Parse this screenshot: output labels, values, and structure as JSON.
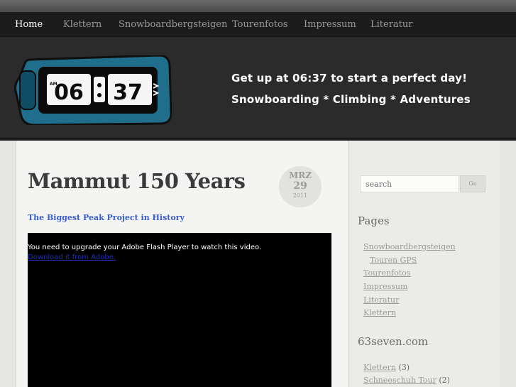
{
  "nav": {
    "items": [
      "Home",
      "Klettern",
      "Snowboardbergsteigen",
      "Tourenfotos",
      "Impressum",
      "Literatur"
    ],
    "active": "Home"
  },
  "header": {
    "clock": {
      "am_label": "AM",
      "hours": "06",
      "minutes": "37"
    },
    "tagline_1": "Get up at 06:37 to start a perfect day!",
    "tagline_2": "Snowboarding * Climbing *  Adventures"
  },
  "post": {
    "title": "Mammut 150 Years",
    "date": {
      "month": "MRZ",
      "day": "29",
      "year": "2011"
    },
    "subtitle": "The Biggest Peak Project in History",
    "video": {
      "message": "You need to upgrade your Adobe Flash Player to watch this video.",
      "link": "Download it from Adobe."
    }
  },
  "sidebar": {
    "search_placeholder": "search",
    "go_label": "Go",
    "pages_heading": "Pages",
    "pages": [
      "Snowboardbergsteigen",
      "Touren GPS",
      "Tourenfotos",
      "Impressum",
      "Literatur",
      "Klettern"
    ],
    "blog_heading": "63seven.com",
    "categories": [
      {
        "label": "Klettern",
        "count": "(3)"
      },
      {
        "label": "Schneeschuh Tour",
        "count": "(2)"
      }
    ]
  },
  "colors": {
    "nav_bg": "#1c1c1c",
    "header_bg": "#2b2b2b",
    "clock_frame": "#1f6f8c",
    "link_blue": "#3a5fcd"
  }
}
